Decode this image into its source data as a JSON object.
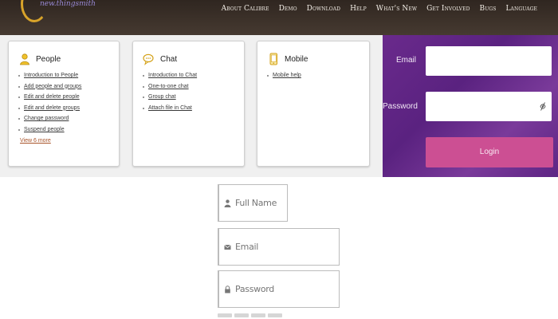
{
  "header": {
    "logo_text": "new.thingsmith",
    "nav": [
      "About Calibre",
      "Demo",
      "Download",
      "Help",
      "What's New",
      "Get Involved",
      "Bugs",
      "Language"
    ]
  },
  "cards": [
    {
      "title": "People",
      "icon": "person-icon",
      "links": [
        "Introduction to People",
        "Add people and groups",
        "Edit and delete people",
        "Edit and delete groups",
        "Change password",
        "Suspend people"
      ],
      "more": "View 6 more"
    },
    {
      "title": "Chat",
      "icon": "chat-bubble-icon",
      "links": [
        "Introduction to Chat",
        "One-to-one chat",
        "Group chat",
        "Attach file in Chat"
      ]
    },
    {
      "title": "Mobile",
      "icon": "mobile-phone-icon",
      "links": [
        "Mobile help"
      ]
    }
  ],
  "login": {
    "email_label": "Email",
    "password_label": "Password",
    "button": "Login"
  },
  "register": {
    "fullname_placeholder": "Full Name",
    "email_placeholder": "Email",
    "password_placeholder": "Password"
  },
  "colors": {
    "header_bg": "#3a2f27",
    "login_bg": "#6a2a8c",
    "login_button": "#cc4f93",
    "link_more": "#a8542a"
  }
}
